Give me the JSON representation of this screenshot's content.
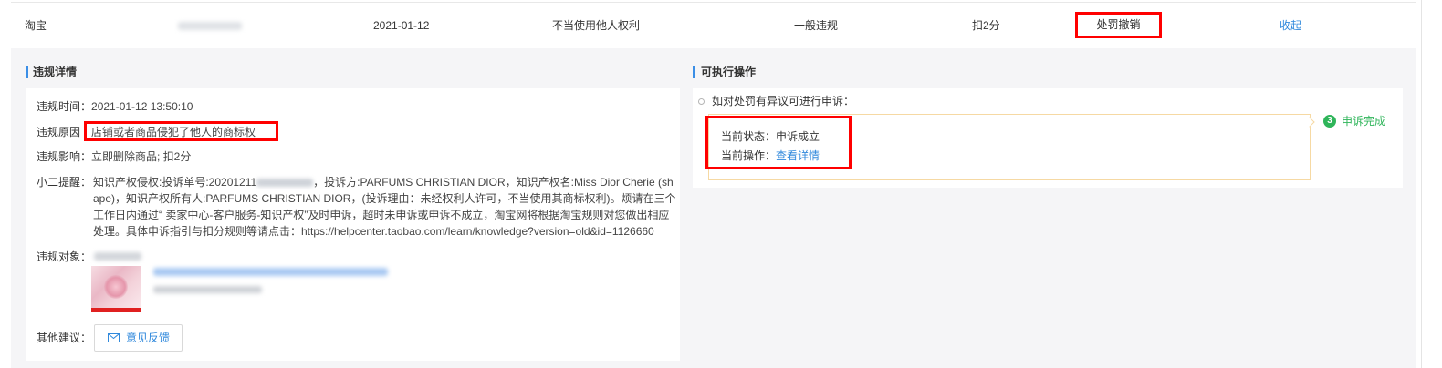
{
  "summary_row": {
    "platform": "淘宝",
    "date": "2021-01-12",
    "violation_type": "不当使用他人权利",
    "severity": "一般违规",
    "deduction": "扣2分",
    "penalty_status": "处罚撤销",
    "collapse_link": "收起"
  },
  "details": {
    "title": "违规详情",
    "time": {
      "label": "违规时间：",
      "value": "2021-01-12 13:50:10"
    },
    "reason": {
      "label": "违规原因",
      "value": "店铺或者商品侵犯了他人的商标权"
    },
    "impact": {
      "label": "违规影响：",
      "value": "立即删除商品; 扣2分"
    },
    "reminder": {
      "label": "小二提醒：",
      "text_before_redaction": "知识产权侵权:投诉单号:20201211",
      "text_after_redaction": "，投诉方:PARFUMS CHRISTIAN DIOR，知识产权名:Miss Dior Cherie (shape)，知识产权所有人:PARFUMS CHRISTIAN DIOR，(投诉理由：未经权利人许可，不当使用其商标权利)。烦请在三个工作日内通过“ 卖家中心-客户服务-知识产权”及时申诉，超时未申诉或申诉不成立，淘宝网将根据淘宝规则对您做出相应处理。具体申诉指引与扣分规则等请点击：https://helpcenter.taobao.com/learn/knowledge?version=old&id=1126660"
    },
    "target": {
      "label": "违规对象："
    },
    "suggestion": {
      "label": "其他建议：",
      "feedback_button": "意见反馈"
    }
  },
  "actions": {
    "title": "可执行操作",
    "appeal_prompt": "如对处罚有异议可进行申诉：",
    "current_status_label": "当前状态：",
    "current_status_value": "申诉成立",
    "current_action_label": "当前操作：",
    "current_action_link": "查看详情",
    "step": {
      "number": "3",
      "label": "申诉完成"
    }
  },
  "icons": {
    "feedback_button": "mail-icon",
    "step_badge": "step-circle-icon",
    "timeline_bullet": "hollow-circle-icon"
  },
  "colors": {
    "link_blue": "#3089dc",
    "highlight_red": "#ff0000",
    "success_green": "#2fb55a",
    "timeline_border": "#f6d9a3",
    "section_bar_blue": "#3a8ee6",
    "panel_background": "#f5f5f7"
  }
}
